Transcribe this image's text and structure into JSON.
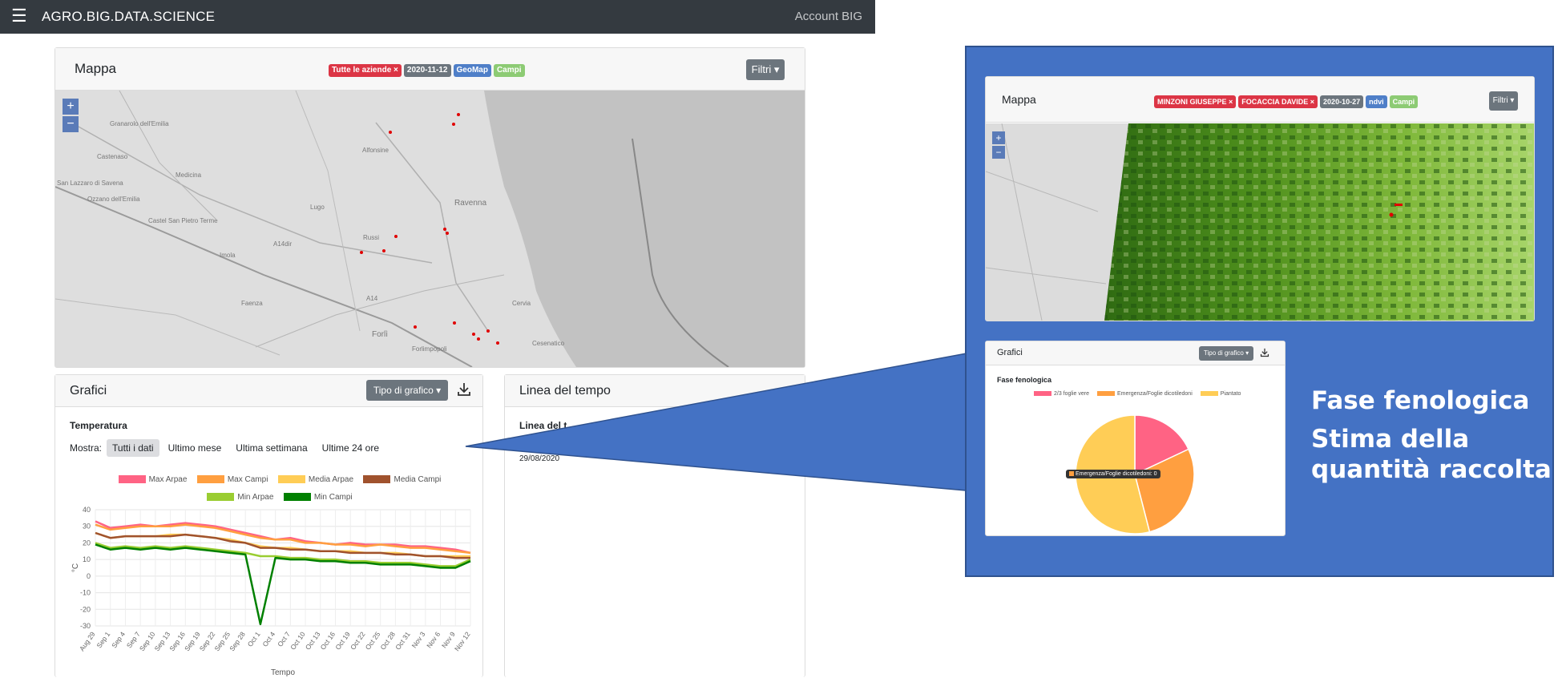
{
  "navbar": {
    "brand": "AGRO.BIG.DATA.SCIENCE",
    "account": "Account BIG"
  },
  "mappa_card": {
    "title": "Mappa",
    "badges": [
      {
        "label": "Tutte le aziende ×",
        "color": "#dc3545"
      },
      {
        "label": "2020-11-12",
        "color": "#6c757d"
      },
      {
        "label": "GeoMap",
        "color": "#4f7fc8"
      },
      {
        "label": "Campi",
        "color": "#8dcb74"
      }
    ],
    "filters_button": "Filtri ▾",
    "zoom_in": "+",
    "zoom_out": "−",
    "place_labels": [
      "Granarolo dell'Emilia",
      "Castenaso",
      "Medicina",
      "San Lazzaro di Savena",
      "Ozzano dell'Emilia",
      "Castel San Pietro Terme",
      "Imola",
      "Faenza",
      "Lugo",
      "Alfonsine",
      "Ravenna",
      "Russi",
      "Cervia",
      "Forlì",
      "Forlimpopoli",
      "Cesenatico",
      "A14",
      "A14dir"
    ]
  },
  "grafici_card": {
    "title": "Grafici",
    "chart_type_button": "Tipo di grafico ▾",
    "chart_title": "Temperatura",
    "show_label": "Mostra:",
    "range_buttons": [
      "Tutti i dati",
      "Ultimo mese",
      "Ultima settimana",
      "Ultime 24 ore"
    ]
  },
  "timeline_card": {
    "title": "Linea del tempo",
    "subtitle": "Linea del t",
    "date": "29/08/2020"
  },
  "chart_data": {
    "type": "line",
    "xlabel": "Tempo",
    "ylabel": "°C",
    "ylim": [
      -30,
      40
    ],
    "yticks": [
      40,
      30,
      20,
      10,
      0,
      -10,
      -20,
      -30
    ],
    "x": [
      "Aug 29",
      "Sep 1",
      "Sep 4",
      "Sep 7",
      "Sep 10",
      "Sep 13",
      "Sep 16",
      "Sep 19",
      "Sep 22",
      "Sep 25",
      "Sep 28",
      "Oct 1",
      "Oct 4",
      "Oct 7",
      "Oct 10",
      "Oct 13",
      "Oct 16",
      "Oct 19",
      "Oct 22",
      "Oct 25",
      "Oct 28",
      "Oct 31",
      "Nov 3",
      "Nov 6",
      "Nov 9",
      "Nov 12"
    ],
    "grid": true,
    "legend_position": "top",
    "series": [
      {
        "name": "Max Arpae",
        "color": "#ff6384",
        "values": [
          33,
          29,
          30,
          31,
          30,
          31,
          32,
          31,
          30,
          28,
          26,
          24,
          22,
          23,
          21,
          20,
          19,
          20,
          19,
          19,
          19,
          18,
          18,
          17,
          16,
          14
        ]
      },
      {
        "name": "Max Campi",
        "color": "#ff9f40",
        "values": [
          31,
          28,
          29,
          30,
          30,
          30,
          31,
          30,
          29,
          27,
          25,
          23,
          22,
          22,
          20,
          20,
          19,
          19,
          18,
          19,
          18,
          17,
          17,
          16,
          15,
          14
        ]
      },
      {
        "name": "Media Arpae",
        "color": "#ffcd56",
        "values": [
          26,
          23,
          24,
          24,
          24,
          25,
          25,
          24,
          23,
          22,
          20,
          18,
          17,
          17,
          16,
          15,
          15,
          15,
          14,
          14,
          14,
          13,
          12,
          12,
          12,
          12
        ]
      },
      {
        "name": "Media Campi",
        "color": "#a0522d",
        "values": [
          26,
          23,
          24,
          24,
          24,
          24,
          25,
          24,
          23,
          21,
          20,
          17,
          17,
          16,
          16,
          15,
          15,
          14,
          14,
          14,
          13,
          13,
          12,
          12,
          11,
          11
        ]
      },
      {
        "name": "Min Arpae",
        "color": "#9acd32",
        "values": [
          20,
          17,
          18,
          17,
          18,
          17,
          18,
          17,
          16,
          15,
          14,
          12,
          12,
          11,
          11,
          10,
          10,
          9,
          9,
          8,
          8,
          8,
          7,
          6,
          6,
          10
        ]
      },
      {
        "name": "Min Campi",
        "color": "#008000",
        "values": [
          19,
          16,
          17,
          16,
          17,
          16,
          17,
          16,
          15,
          14,
          13,
          -29,
          11,
          10,
          10,
          9,
          9,
          8,
          8,
          7,
          7,
          7,
          6,
          5,
          5,
          9
        ]
      }
    ]
  },
  "inset": {
    "map_card": {
      "title": "Mappa",
      "badges": [
        {
          "label": "MINZONI GIUSEPPE ×",
          "color": "#dc3545"
        },
        {
          "label": "FOCACCIA DAVIDE ×",
          "color": "#dc3545"
        },
        {
          "label": "2020-10-27",
          "color": "#6c757d"
        },
        {
          "label": "ndvi",
          "color": "#4f7fc8"
        },
        {
          "label": "Campi",
          "color": "#8dcb74"
        }
      ],
      "filters_button": "Filtri ▾",
      "zoom_in": "+",
      "zoom_out": "−"
    },
    "grafici_card": {
      "title": "Grafici",
      "chart_type_button": "Tipo di grafico ▾",
      "chart_title": "Fase fenologica",
      "tooltip": "Emergenza/Foglie dicotiledoni: 0"
    },
    "pie_data": {
      "type": "pie",
      "title": "Fase fenologica",
      "categories": [
        "2/3 foglie vere",
        "Emergenza/Foglie dicotiledoni",
        "Piantato"
      ],
      "values": [
        18,
        28,
        54
      ],
      "colors": [
        "#ff6384",
        "#ff9f40",
        "#ffcd56"
      ]
    }
  },
  "callout_text": {
    "line1": "Fase fenologica",
    "line2": "Stima della",
    "line3": "quantità raccolta"
  }
}
